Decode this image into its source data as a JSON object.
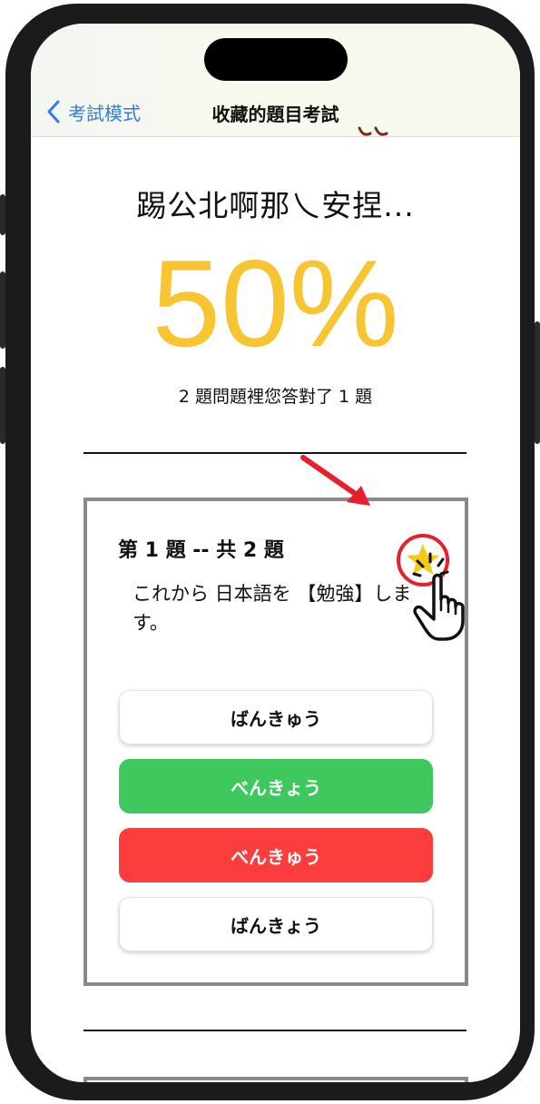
{
  "nav": {
    "back_label": "考試模式",
    "title": "收藏的題目考試"
  },
  "result": {
    "question_name": "踢公北啊那乀安捏...",
    "percent": "50%",
    "summary": "2 題問題裡您答對了 1 題"
  },
  "question": {
    "label": "第 1 題 -- 共 2 題",
    "text": "これから 日本語を 【勉強】します。",
    "favorited": true,
    "options": [
      {
        "label": "ばんきゅう",
        "state": "normal"
      },
      {
        "label": "べんきょう",
        "state": "correct"
      },
      {
        "label": "べんきゅう",
        "state": "wrong"
      },
      {
        "label": "ばんきょう",
        "state": "normal"
      }
    ]
  },
  "colors": {
    "accent_blue": "#2f7de1",
    "percent_yellow": "#f7c531",
    "correct_green": "#3fc85e",
    "wrong_red": "#fc3d3d",
    "annotation_red": "#e8202b",
    "star_yellow": "#f8c816"
  },
  "icons": {
    "back": "chevron-left-icon",
    "favorite": "star-icon",
    "annotation_arrow": "arrow-icon",
    "annotation_hand": "hand-pointer-icon"
  }
}
